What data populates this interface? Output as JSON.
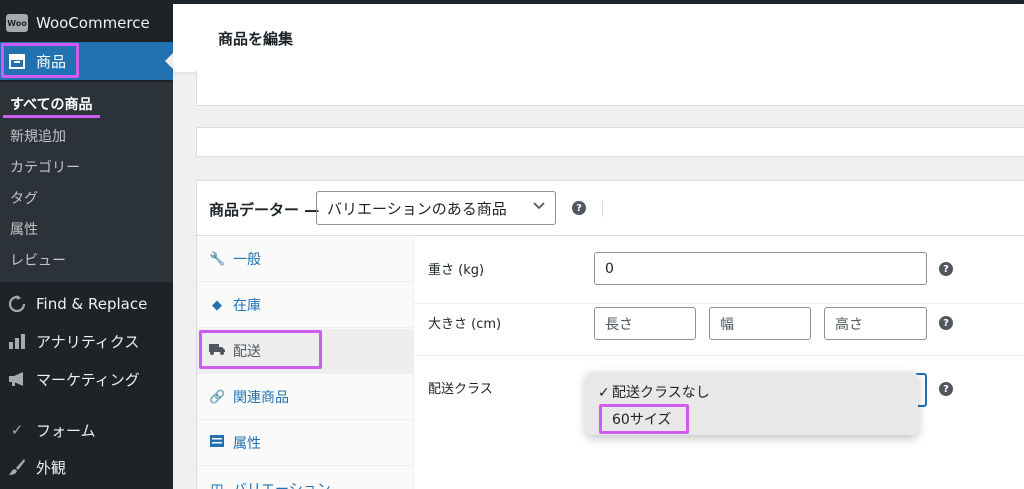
{
  "sidebar": {
    "brand": "WooCommerce",
    "products": "商品",
    "submenu": [
      "すべての商品",
      "新規追加",
      "カテゴリー",
      "タグ",
      "属性",
      "レビュー"
    ],
    "menu": [
      "Find & Replace",
      "アナリティクス",
      "マーケティング",
      "フォーム",
      "外観"
    ]
  },
  "header": {
    "title": "商品を編集"
  },
  "product_data": {
    "label": "商品データー —",
    "type_value": "バリエーションのある商品",
    "help": "?",
    "tabs": [
      "一般",
      "在庫",
      "配送",
      "関連商品",
      "属性",
      "バリエーション"
    ],
    "active_tab": "配送"
  },
  "shipping": {
    "weight_label": "重さ (kg)",
    "weight_value": "0",
    "dims_label": "大きさ (cm)",
    "length_ph": "長さ",
    "width_ph": "幅",
    "height_ph": "高さ",
    "class_label": "配送クラス",
    "class_options": [
      "配送クラスなし",
      "60サイズ"
    ],
    "selected_option": "配送クラスなし"
  },
  "colors": {
    "accent": "#2271b1",
    "highlight": "#cf5cf0",
    "sidebar": "#1d2327"
  }
}
